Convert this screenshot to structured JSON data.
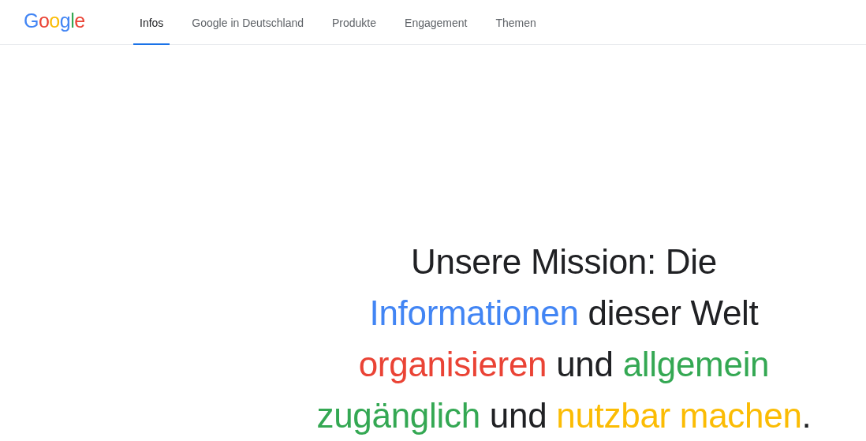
{
  "logo": {
    "letters": [
      {
        "text": "G",
        "color": "#4285f4"
      },
      {
        "text": "o",
        "color": "#ea4335"
      },
      {
        "text": "o",
        "color": "#fbbc04"
      },
      {
        "text": "g",
        "color": "#4285f4"
      },
      {
        "text": "l",
        "color": "#34a853"
      },
      {
        "text": "e",
        "color": "#ea4335"
      }
    ]
  },
  "nav": [
    {
      "label": "Infos",
      "selected": true
    },
    {
      "label": "Google in Deutschland",
      "selected": false
    },
    {
      "label": "Produkte",
      "selected": false
    },
    {
      "label": "Engagement",
      "selected": false
    },
    {
      "label": "Themen",
      "selected": false
    }
  ],
  "headline": {
    "lines": [
      [
        {
          "text": "Unsere Mission: Die",
          "color": "#202124"
        }
      ],
      [
        {
          "text": "Informationen",
          "color": "#4285f4"
        },
        {
          "text": " dieser Welt",
          "color": "#202124"
        }
      ],
      [
        {
          "text": "organisieren",
          "color": "#ea4335"
        },
        {
          "text": " und ",
          "color": "#202124"
        },
        {
          "text": "allgemein",
          "color": "#34a853"
        }
      ],
      [
        {
          "text": "zugänglich",
          "color": "#34a853"
        },
        {
          "text": " und ",
          "color": "#202124"
        },
        {
          "text": "nutzbar machen",
          "color": "#fbbc04"
        },
        {
          "text": ".",
          "color": "#202124"
        }
      ]
    ]
  }
}
